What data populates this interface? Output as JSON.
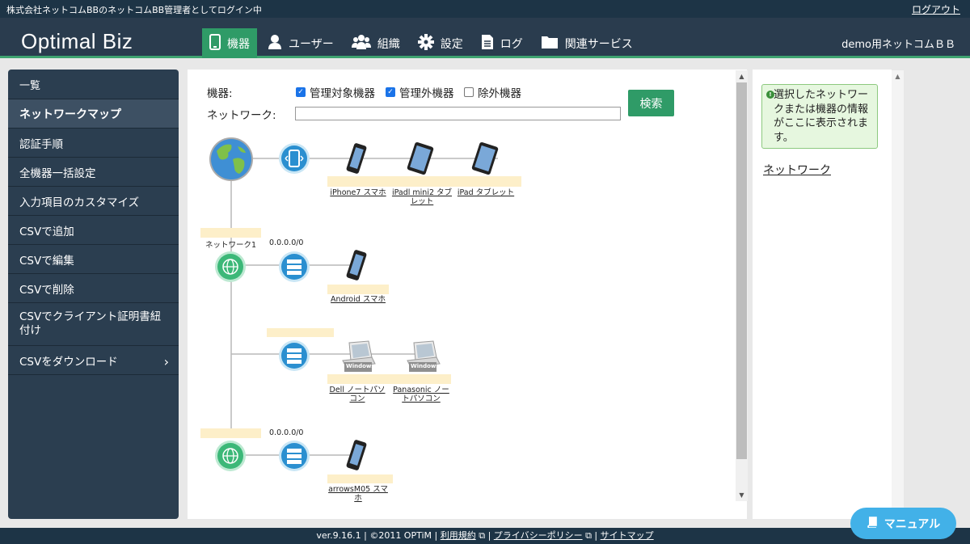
{
  "topbar": {
    "login_text": "株式会社ネットコムBBのネットコムBB管理者としてログイン中",
    "logout": "ログアウト"
  },
  "header": {
    "logo": "Optimal Biz",
    "org": "demo用ネットコムＢＢ",
    "tabs": [
      {
        "label": "機器",
        "icon": "phone-icon",
        "active": true
      },
      {
        "label": "ユーザー",
        "icon": "user-icon"
      },
      {
        "label": "組織",
        "icon": "group-icon"
      },
      {
        "label": "設定",
        "icon": "gear-icon"
      },
      {
        "label": "ログ",
        "icon": "document-icon"
      },
      {
        "label": "関連サービス",
        "icon": "folder-icon"
      }
    ]
  },
  "sidebar": {
    "items": [
      {
        "label": "一覧"
      },
      {
        "label": "ネットワークマップ",
        "active": true
      },
      {
        "label": "認証手順"
      },
      {
        "label": "全機器一括設定"
      },
      {
        "label": "入力項目のカスタマイズ"
      },
      {
        "label": "CSVで追加"
      },
      {
        "label": "CSVで編集"
      },
      {
        "label": "CSVで削除"
      },
      {
        "label": "CSVでクライアント証明書紐付け"
      },
      {
        "label": "CSVをダウンロード"
      }
    ]
  },
  "filter": {
    "device_label": "機器:",
    "network_label": "ネットワーク:",
    "network_value": "",
    "checkboxes": [
      {
        "label": "管理対象機器",
        "checked": true
      },
      {
        "label": "管理外機器",
        "checked": true
      },
      {
        "label": "除外機器",
        "checked": false
      }
    ],
    "search_label": "検索"
  },
  "map": {
    "networks": [
      {
        "name": "ネットワーク1",
        "address": "0.0.0.0/0"
      },
      {
        "name": "",
        "address": ""
      },
      {
        "name": "",
        "address": "0.0.0.0/0"
      }
    ],
    "devices": [
      {
        "label": "iPhone7 スマホ",
        "type": "smartphone"
      },
      {
        "label": "iPadl mini2 タブレット",
        "type": "tablet"
      },
      {
        "label": "iPad タブレット",
        "type": "tablet"
      },
      {
        "label": "Android スマホ",
        "type": "smartphone"
      },
      {
        "label": "Dell ノートパソコン",
        "type": "windows-laptop"
      },
      {
        "label": "Panasonic ノートパソコン",
        "type": "windows-laptop"
      },
      {
        "label": "arrowsM05 スマホ",
        "type": "smartphone"
      }
    ],
    "laptop_badge": "Windows"
  },
  "info": {
    "message": "選択したネットワークまたは機器の情報がここに表示されます。",
    "network_link": "ネットワーク"
  },
  "footer": {
    "version": "ver.9.16.1 | ©2011 OPTiM | ",
    "terms": "利用規約",
    "privacy": "プライバシーポリシー",
    "sitemap": "サイトマップ"
  },
  "manual": {
    "label": "マニュアル"
  },
  "colors": {
    "accent": "#2f9b67",
    "header": "#2a3c4e",
    "sidebar": "#2b3e50",
    "highlight": "#fdefc9",
    "manual": "#42b1e8"
  }
}
